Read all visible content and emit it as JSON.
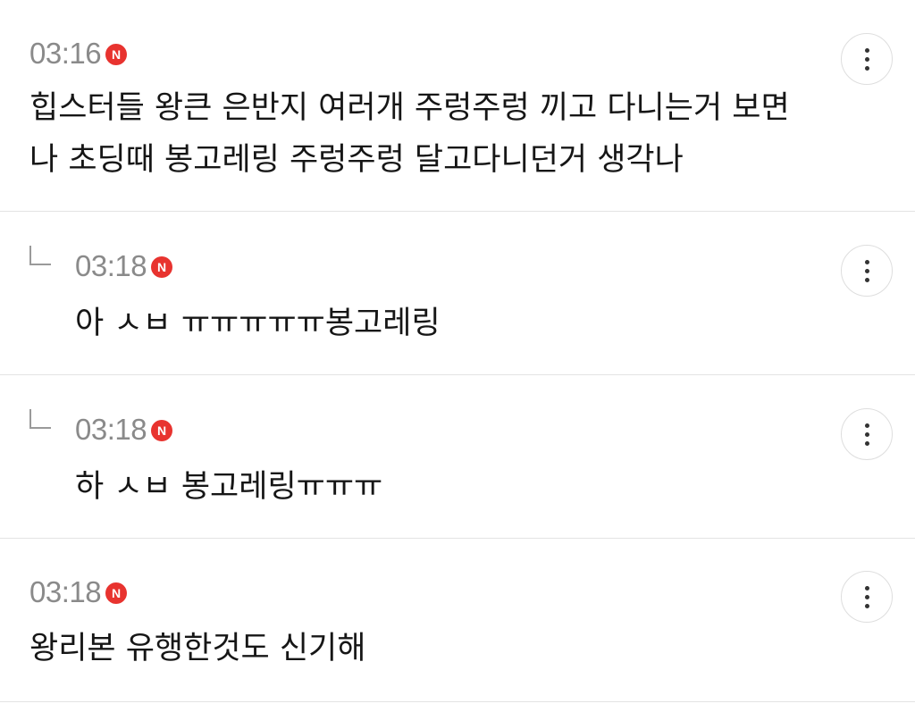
{
  "comments": [
    {
      "time": "03:16",
      "badge": "N",
      "is_reply": false,
      "lines": [
        "힙스터들 왕큰 은반지 여러개 주렁주렁 끼고 다니는거 보면",
        "나 초딩때 봉고레링 주렁주렁 달고다니던거 생각나"
      ]
    },
    {
      "time": "03:18",
      "badge": "N",
      "is_reply": true,
      "lines": [
        "아 ㅅㅂ ㅠㅠㅠㅠㅠ봉고레링"
      ]
    },
    {
      "time": "03:18",
      "badge": "N",
      "is_reply": true,
      "lines": [
        "하 ㅅㅂ 봉고레링ㅠㅠㅠ"
      ]
    },
    {
      "time": "03:18",
      "badge": "N",
      "is_reply": false,
      "lines": [
        "왕리본 유행한것도 신기해"
      ]
    }
  ],
  "colors": {
    "badge": "#e8332f",
    "time": "#8a8a8a",
    "divider": "#e3e3e3"
  },
  "icons": {
    "more": "vertical-ellipsis-icon",
    "reply": "reply-arrow-icon"
  }
}
